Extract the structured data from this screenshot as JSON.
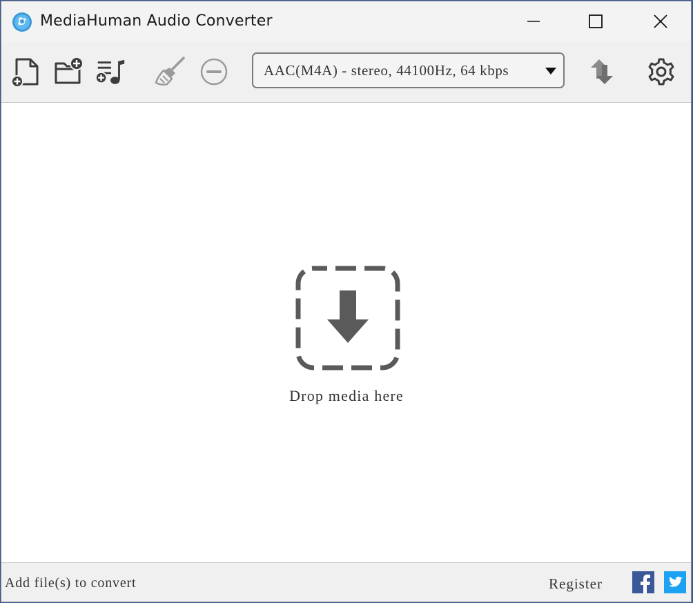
{
  "window": {
    "title": "MediaHuman Audio Converter"
  },
  "toolbar": {
    "format_value": "AAC(M4A) - stereo, 44100Hz, 64 kbps",
    "icons": [
      "add-file-icon",
      "add-folder-icon",
      "add-playlist-icon",
      "clear-list-icon",
      "remove-icon",
      "convert-icon",
      "settings-icon"
    ]
  },
  "dropzone": {
    "label": "Drop media here"
  },
  "statusbar": {
    "status": "Add file(s) to convert",
    "register_label": "Register"
  },
  "colors": {
    "icon_gray": "#4a4a4a",
    "dropzone_icon": "#5a5a5a",
    "facebook": "#3b5998",
    "twitter": "#1da1f2",
    "app_icon": "#3a9ad9"
  }
}
